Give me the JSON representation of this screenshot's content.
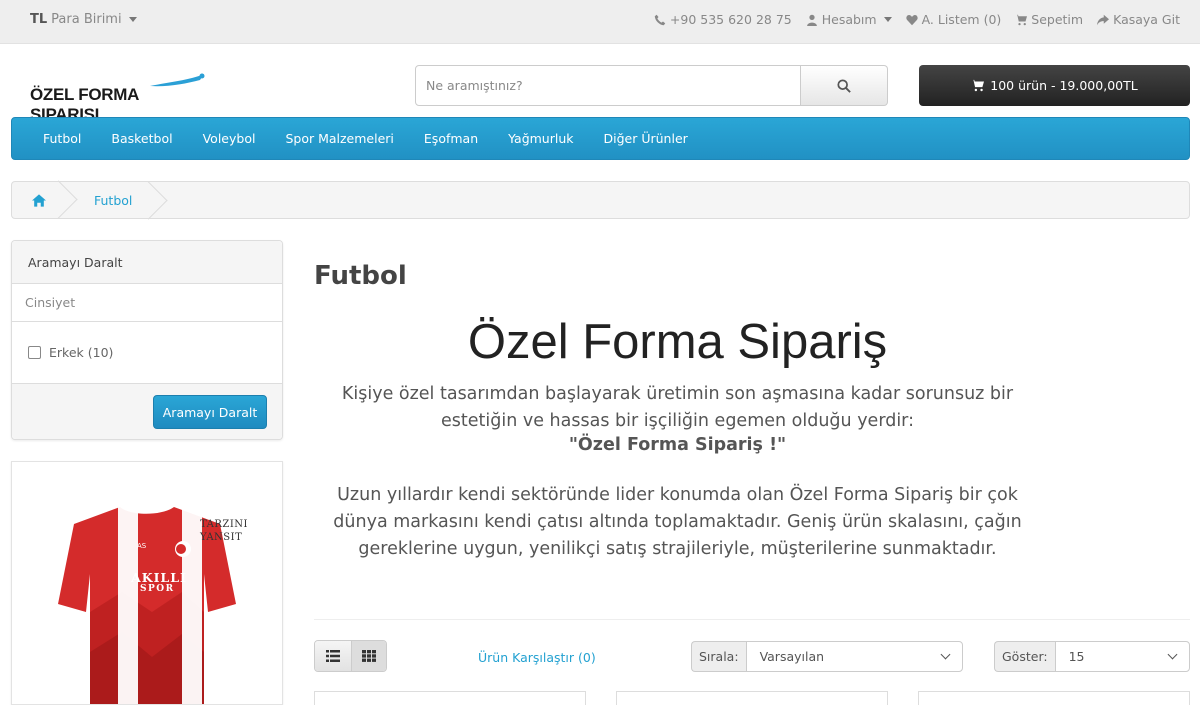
{
  "topbar": {
    "currency_code": "TL",
    "currency_label": "Para Birimi",
    "phone": "+90 535 620 28 75",
    "account": "Hesabım",
    "wishlist": "A. Listem (0)",
    "cart": "Sepetim",
    "checkout": "Kasaya Git"
  },
  "header": {
    "logo_text": "ÖZEL FORMA SIPARISI",
    "search_placeholder": "Ne aramıştınız?",
    "cart_summary": "100 ürün - 19.000,00TL"
  },
  "menu": {
    "items": [
      "Futbol",
      "Basketbol",
      "Voleybol",
      "Spor Malzemeleri",
      "Eşofman",
      "Yağmurluk",
      "Diğer Ürünler"
    ]
  },
  "breadcrumb": {
    "current": "Futbol"
  },
  "filter": {
    "title": "Aramayı Daralt",
    "group": "Cinsiyet",
    "option": "Erkek (10)",
    "button": "Aramayı Daralt"
  },
  "banner": {
    "slogan_line1": "TARZINI",
    "slogan_line2": "YANSIT",
    "brand_line1": "AKILLI",
    "brand_line2": "SPOR",
    "jersey_color": "#d42b2b"
  },
  "content": {
    "page_title": "Futbol",
    "hero_title": "Özel Forma Sipariş",
    "hero_p1": "Kişiye özel tasarımdan başlayarak üretimin son aşmasına kadar sorunsuz bir estetiğin ve hassas bir işçiliğin egemen olduğu yerdir:",
    "hero_strong": "\"Özel Forma Sipariş !\"",
    "hero_p2": "Uzun yıllardır kendi sektöründe lider konumda olan Özel Forma Sipariş bir çok dünya markasını kendi çatısı altında toplamaktadır. Geniş ürün skalasını, çağın gereklerine uygun, yenilikçi satış strajileriyle, müşterilerine sunmaktadır."
  },
  "toolbar": {
    "compare": "Ürün Karşılaştır (0)",
    "sort_label": "Sırala:",
    "sort_value": "Varsayılan",
    "show_label": "Göster:",
    "show_value": "15"
  },
  "colors": {
    "accent": "#23a1d1",
    "menu_bg": "#229ccb",
    "cart_bg": "#303030"
  }
}
